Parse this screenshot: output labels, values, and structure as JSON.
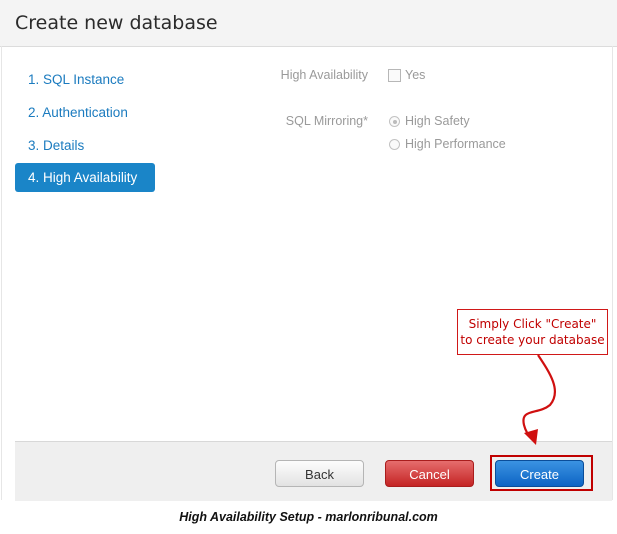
{
  "dialog": {
    "title": "Create new database"
  },
  "steps": [
    {
      "label": "1. SQL Instance"
    },
    {
      "label": "2. Authentication"
    },
    {
      "label": "3. Details"
    },
    {
      "label": "4. High Availability"
    }
  ],
  "form": {
    "high_availability": {
      "label": "High Availability",
      "option": "Yes",
      "checked": false
    },
    "sql_mirroring": {
      "label": "SQL Mirroring*",
      "options": [
        {
          "label": "High Safety",
          "selected": true
        },
        {
          "label": "High Performance",
          "selected": false
        }
      ]
    }
  },
  "footer": {
    "back_label": "Back",
    "cancel_label": "Cancel",
    "create_label": "Create"
  },
  "annotation": {
    "line1": "Simply Click \"Create\"",
    "line2": "to create your database"
  },
  "caption": "High Availability Setup - marlonribunal.com",
  "colors": {
    "accent": "#1a85c8",
    "cancel": "#c42424",
    "create": "#0d64c4",
    "annotation": "#c00000"
  }
}
